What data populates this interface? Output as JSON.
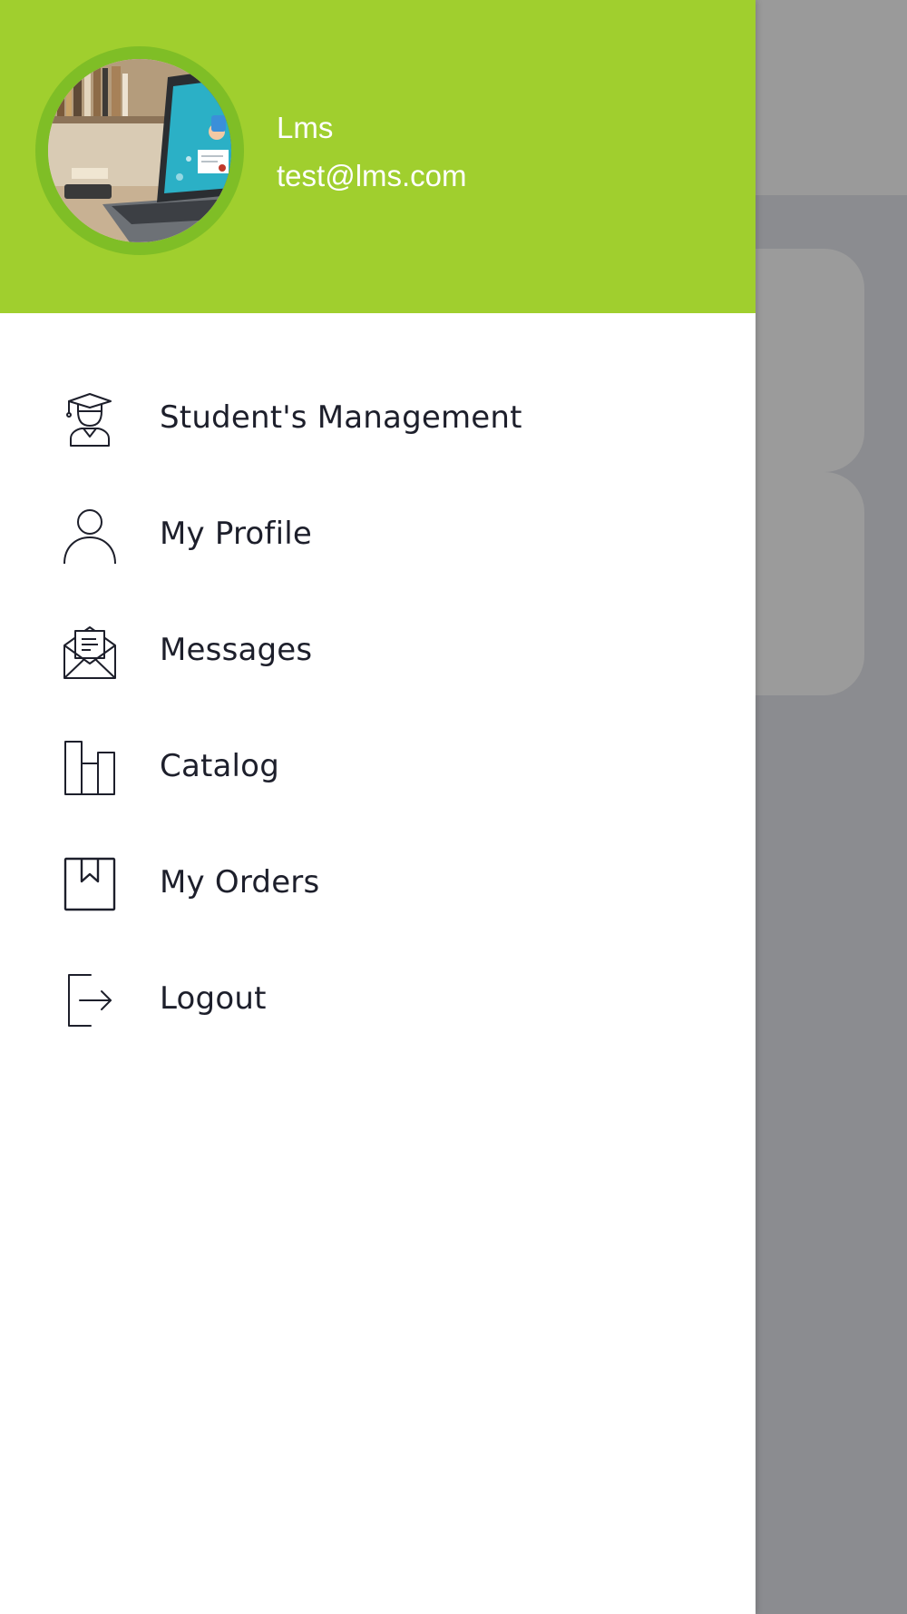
{
  "drawer": {
    "user": {
      "name": "Lms",
      "email": "test@lms.com"
    },
    "menu": [
      {
        "label": "Student's Management",
        "icon": "graduate-icon"
      },
      {
        "label": "My Profile",
        "icon": "user-icon"
      },
      {
        "label": "Messages",
        "icon": "open-envelope-icon"
      },
      {
        "label": "Catalog",
        "icon": "catalog-icon"
      },
      {
        "label": "My Orders",
        "icon": "bookmark-icon"
      },
      {
        "label": "Logout",
        "icon": "logout-icon"
      }
    ]
  },
  "colors": {
    "header_green": "#a0cf2e",
    "avatar_ring": "#7fbe26",
    "menu_text": "#1d1f2b",
    "overlay": "#8b8c90"
  }
}
